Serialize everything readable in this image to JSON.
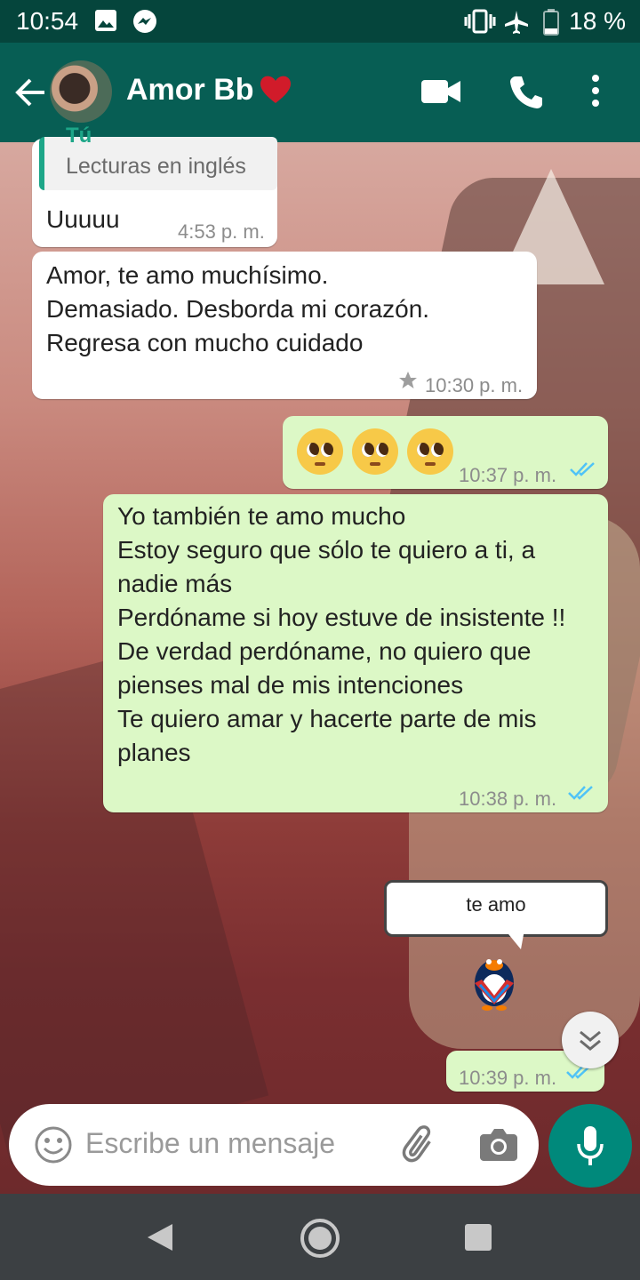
{
  "status_bar": {
    "time": "10:54",
    "battery_percent": "18 %",
    "icons": [
      "image-icon",
      "messenger-icon",
      "vibrate-icon",
      "airplane-icon",
      "battery-icon"
    ]
  },
  "header": {
    "contact_name": "Amor Bb",
    "icons": [
      "back-arrow-icon",
      "heart-icon",
      "video-call-icon",
      "phone-call-icon",
      "more-vert-icon"
    ]
  },
  "messages": [
    {
      "direction": "incoming",
      "quoted_author": "Tú",
      "quoted_text": "Lecturas en inglés",
      "text": "Uuuuu",
      "time": "4:53 p. m."
    },
    {
      "direction": "incoming",
      "text": "Amor, te amo muchísimo.\nDemasiado. Desborda mi corazón.\nRegresa con mucho cuidado",
      "time": "10:30 p. m.",
      "starred": true
    },
    {
      "direction": "outgoing",
      "emojis": [
        "pleading-face",
        "pleading-face",
        "pleading-face"
      ],
      "time": "10:37 p. m.",
      "status": "read"
    },
    {
      "direction": "outgoing",
      "text": "Yo también te amo mucho\nEstoy seguro que sólo te quiero a ti, a nadie más\nPerdóname si hoy estuve de insistente !! De verdad perdóname, no quiero que pienses mal de mis intenciones\nTe quiero amar y hacerte parte de mis planes",
      "time": "10:38 p. m.",
      "status": "read"
    },
    {
      "direction": "outgoing",
      "sticker_text": "te amo",
      "sticker_icon": "penguin-sticker-icon",
      "time": "10:39 p. m.",
      "status": "read"
    }
  ],
  "input": {
    "placeholder": "Escribe un mensaje",
    "icons": [
      "emoji-icon",
      "attach-icon",
      "camera-icon",
      "mic-icon"
    ]
  },
  "nav_bar": {
    "icons": [
      "back-nav-icon",
      "home-nav-icon",
      "recents-nav-icon"
    ]
  },
  "colors": {
    "header": "#075e54",
    "status_bar": "#05453c",
    "outgoing_bubble": "#dcf8c6",
    "incoming_bubble": "#ffffff",
    "read_ticks": "#4fc3f7",
    "mic_button": "#00897b"
  }
}
